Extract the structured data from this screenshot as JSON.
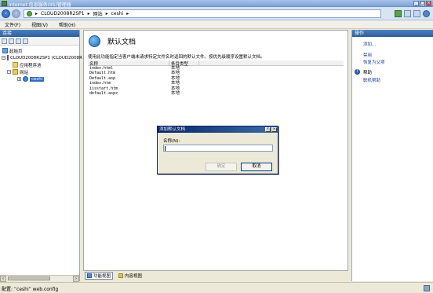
{
  "window": {
    "title": "Internet 信息服务(IIS)管理器",
    "controls": [
      "_",
      "□",
      "×"
    ]
  },
  "address": {
    "segments": [
      "CLOUD2008R2SP1",
      "网站",
      "ceshi"
    ],
    "separator": "▸"
  },
  "menu": {
    "items": [
      "文件(F)",
      "视图(V)",
      "帮助(H)"
    ]
  },
  "connections": {
    "header": "连接",
    "tree": [
      {
        "label": "起始页",
        "expand": ""
      },
      {
        "label": "CLOUD2008R2SP1 (CLOUD2008R",
        "expand": "−"
      },
      {
        "label": "应用程序池",
        "expand": ""
      },
      {
        "label": "网站",
        "expand": "−"
      },
      {
        "label": "ceshi",
        "expand": "+"
      }
    ]
  },
  "main": {
    "title": "默认文档",
    "description": "使用此功能指定当客户端未请求特定文件名时返回的默认文件。按优先级顺序设置默认文档。",
    "columns": [
      "名称",
      "条目类型"
    ],
    "rows": [
      {
        "name": "index.html",
        "type": "本地"
      },
      {
        "name": "Default.htm",
        "type": "本地"
      },
      {
        "name": "Default.asp",
        "type": "本地"
      },
      {
        "name": "index.htm",
        "type": "本地"
      },
      {
        "name": "iisstart.htm",
        "type": "本地"
      },
      {
        "name": "default.aspx",
        "type": "本地"
      }
    ]
  },
  "bottom_tabs": {
    "features": "功能视图",
    "content": "内容视图"
  },
  "actions": {
    "header": "操作",
    "add": "添加...",
    "disable": "禁用",
    "revert": "恢复为父项",
    "help_group": "帮助",
    "online_help": "联机帮助"
  },
  "status": {
    "text": "配置: “ceshi” web.config"
  },
  "dialog": {
    "title": "添加默认文档",
    "help_btn": "?",
    "close_btn": "×",
    "name_label": "名称(N):",
    "name_value": "",
    "ok_label": "确定",
    "cancel_label": "取消"
  }
}
